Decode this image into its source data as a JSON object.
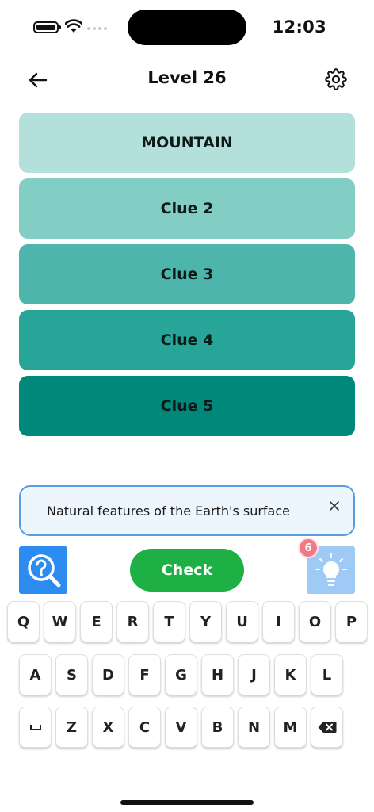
{
  "status_bar": {
    "time": "12:03"
  },
  "header": {
    "title": "Level 26"
  },
  "clues": [
    {
      "label": "MOUNTAIN"
    },
    {
      "label": "Clue 2"
    },
    {
      "label": "Clue 3"
    },
    {
      "label": "Clue 4"
    },
    {
      "label": "Clue 5"
    }
  ],
  "hint_banner": {
    "text": "Natural features of the Earth's surface"
  },
  "actions": {
    "check_label": "Check",
    "hint_count": "6"
  },
  "keyboard": {
    "row1": [
      "Q",
      "W",
      "E",
      "R",
      "T",
      "Y",
      "U",
      "I",
      "O",
      "P"
    ],
    "row2": [
      "A",
      "S",
      "D",
      "F",
      "G",
      "H",
      "J",
      "K",
      "L"
    ],
    "row3": [
      "␣",
      "Z",
      "X",
      "C",
      "V",
      "B",
      "N",
      "M",
      "⌫"
    ]
  },
  "colors": {
    "clue_1": "#b3e0db",
    "clue_2": "#82cdc4",
    "clue_3": "#4db5ab",
    "clue_4": "#27a598",
    "clue_5": "#00897a",
    "check_button": "#1fb045",
    "search_button": "#2d8cf0",
    "hint_button": "#9fcaf6",
    "badge": "#f07a86"
  },
  "icons": {
    "back": "back-arrow-icon",
    "settings": "gear-icon",
    "close": "close-icon",
    "search": "search-question-icon",
    "hint": "lightbulb-icon",
    "space": "space-icon",
    "backspace": "backspace-icon"
  }
}
